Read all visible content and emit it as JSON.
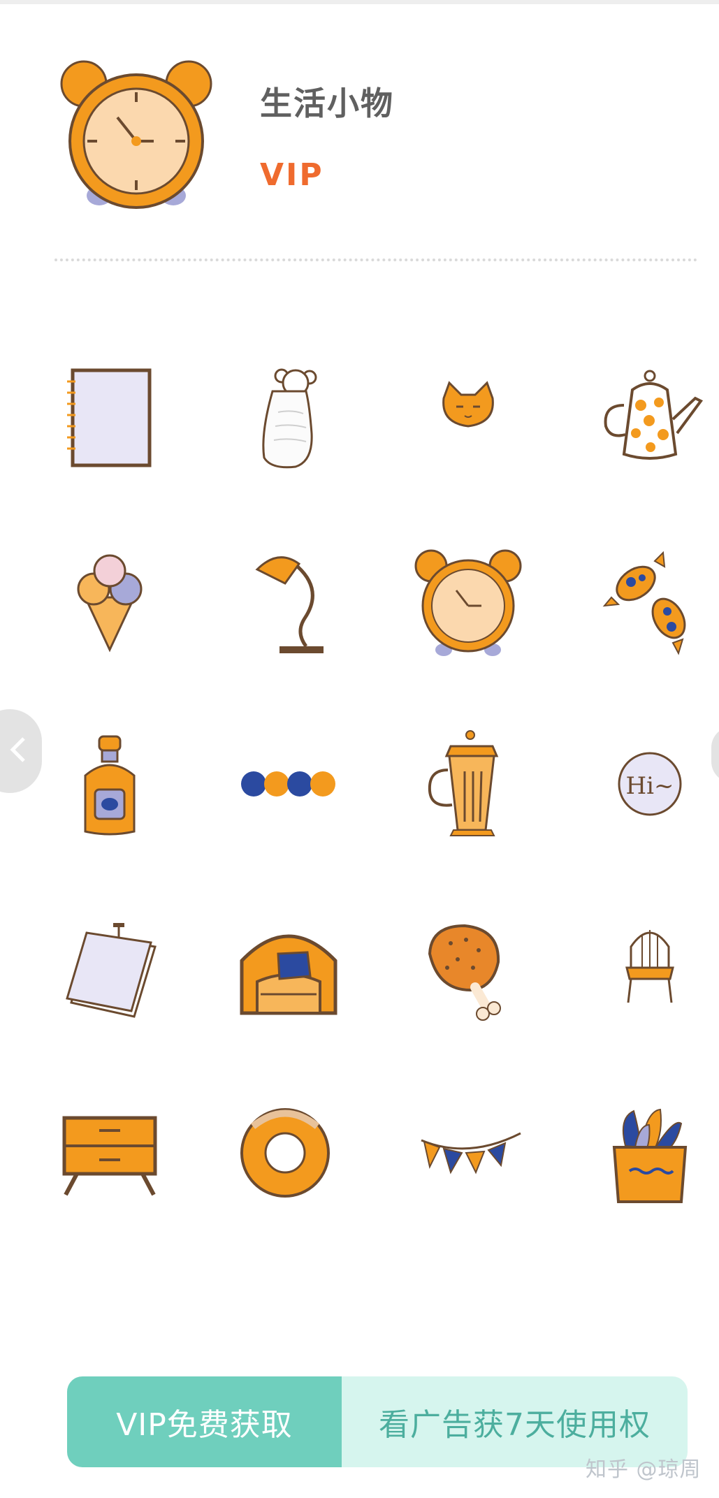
{
  "header": {
    "title": "生活小物",
    "badge": "VIP",
    "icon": "alarm-clock-icon"
  },
  "stickers": [
    "notebook-icon",
    "mouse-in-bag-icon",
    "cat-face-icon",
    "teapot-icon",
    "ice-cream-cone-icon",
    "desk-lamp-icon",
    "alarm-clock-icon",
    "candies-icon",
    "bottle-icon",
    "dot-row-icon",
    "pitcher-icon",
    "hi-speech-bubble-icon",
    "paper-sheets-icon",
    "armchair-icon",
    "chicken-leg-icon",
    "chair-icon",
    "nightstand-icon",
    "donut-icon",
    "bunting-flags-icon",
    "potted-plant-icon"
  ],
  "sticker_text": {
    "hi_bubble": "Hi~"
  },
  "actions": {
    "vip_label": "VIP免费获取",
    "ad_label": "看广告获7天使用权"
  },
  "watermark": "知乎 @琼周",
  "colors": {
    "accent_orange": "#f39a1e",
    "badge_orange": "#ef6b2e",
    "outline_brown": "#6b4a2f",
    "navy": "#2b4aa0",
    "lavender": "#e8e6f6",
    "vip_green": "#6fcfbd",
    "ad_mint": "#d6f5ee"
  }
}
